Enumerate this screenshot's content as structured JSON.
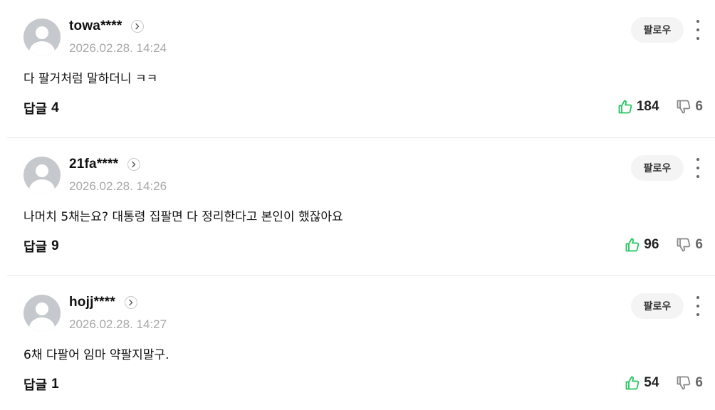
{
  "colors": {
    "like_icon": "#22c55e",
    "dislike_icon": "#888888",
    "avatar_bg": "#c5c8cc",
    "timestamp": "#a8a8a8",
    "follow_bg": "#f4f4f5"
  },
  "icons": {
    "avatar": "default-user-avatar",
    "profile_link": "chevron-right-circle-icon",
    "more": "vertical-ellipsis-icon",
    "like": "thumbs-up-icon",
    "dislike": "thumbs-down-icon"
  },
  "comments": [
    {
      "username": "towa****",
      "timestamp": "2026.02.28. 14:24",
      "follow_label": "팔로우",
      "text": "다 팔거처럼 말하더니 ㅋㅋ",
      "reply_label": "답글",
      "reply_count": "4",
      "likes": "184",
      "dislikes": "6"
    },
    {
      "username": "21fa****",
      "timestamp": "2026.02.28. 14:26",
      "follow_label": "팔로우",
      "text": "나머치 5채는요? 대통령 집팔면 다 정리한다고 본인이 했잖아요",
      "reply_label": "답글",
      "reply_count": "9",
      "likes": "96",
      "dislikes": "6"
    },
    {
      "username": "hojj****",
      "timestamp": "2026.02.28. 14:27",
      "follow_label": "팔로우",
      "text": "6채 다팔어 임마 약팔지말구.",
      "reply_label": "답글",
      "reply_count": "1",
      "likes": "54",
      "dislikes": "6"
    }
  ]
}
